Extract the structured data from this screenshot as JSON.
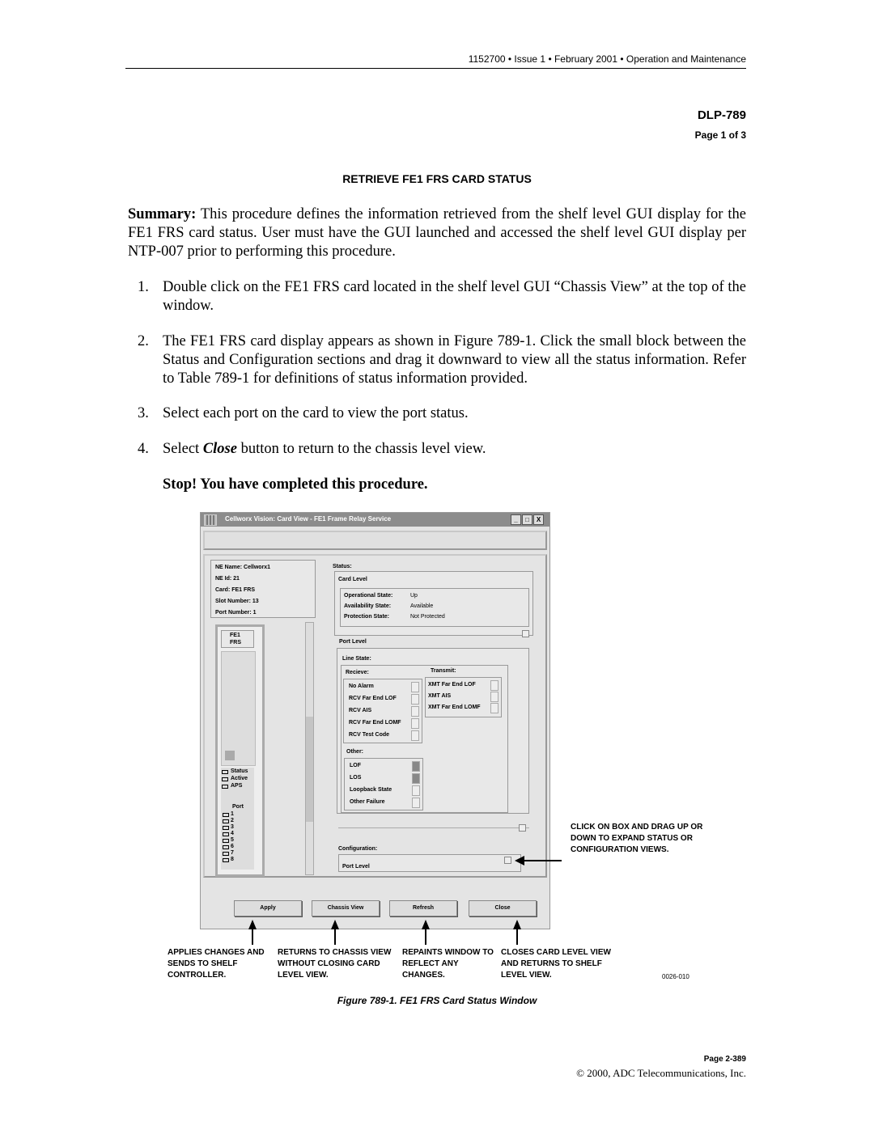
{
  "header": {
    "running": "1152700 • Issue 1 • February 2001 • Operation and Maintenance",
    "dlp": "DLP-789",
    "page": "Page 1 of 3"
  },
  "title": "RETRIEVE FE1 FRS CARD STATUS",
  "summary": {
    "label": "Summary:",
    "text": " This procedure defines the information retrieved from the shelf level GUI display for the FE1 FRS card status. User must have the GUI launched and accessed the shelf level GUI display per NTP-007 prior to performing this procedure."
  },
  "steps": [
    {
      "n": "1.",
      "text": "Double click on the FE1 FRS card located in the shelf level GUI “Chassis View” at the top of the window."
    },
    {
      "n": "2.",
      "text": "The FE1 FRS card display appears as shown in Figure 789-1. Click the small block between the Status and Configuration sections and drag it downward to view all the status information. Refer to Table 789-1 for definitions of status information provided."
    },
    {
      "n": "3.",
      "text": "Select each port on the card to view the port status."
    },
    {
      "n": "4.",
      "pre": "Select ",
      "em": "Close",
      "post": " button to return to the chassis level view."
    }
  ],
  "stop": "Stop! You have completed this procedure.",
  "window": {
    "title": "Cellworx Vision:   Card View - FE1 Frame Relay Service",
    "controls": [
      "_",
      "□",
      "X"
    ],
    "info": [
      "NE Name: Cellworx1",
      "NE Id:  21",
      "Card: FE1 FRS",
      "Slot Number:  13",
      "Port Number:  1"
    ],
    "card_label": [
      "FE1",
      "FRS"
    ],
    "leds": [
      "Status",
      "Active",
      "APS"
    ],
    "port_label": "Port",
    "ports": [
      "1",
      "2",
      "3",
      "4",
      "5",
      "6",
      "7",
      "8"
    ],
    "status_label": "Status:",
    "card_level": "Card Level",
    "states": [
      {
        "k": "Operational State:",
        "v": "Up"
      },
      {
        "k": "Availability State:",
        "v": "Available"
      },
      {
        "k": "Protection State:",
        "v": "Not Protected"
      }
    ],
    "port_level": "Port Level",
    "line_state": "Line State:",
    "receive_label": "Recieve:",
    "receive": [
      {
        "l": "No Alarm",
        "on": false
      },
      {
        "l": "RCV Far End LOF",
        "on": false
      },
      {
        "l": "RCV AIS",
        "on": false
      },
      {
        "l": "RCV Far End LOMF",
        "on": false
      },
      {
        "l": "RCV Test Code",
        "on": false
      }
    ],
    "transmit_label": "Transmit:",
    "transmit": [
      {
        "l": "XMT Far End LOF",
        "on": false
      },
      {
        "l": "XMT AIS",
        "on": false
      },
      {
        "l": "XMT Far End LOMF",
        "on": false
      }
    ],
    "other_label": "Other:",
    "other": [
      {
        "l": "LOF",
        "on": true
      },
      {
        "l": "LOS",
        "on": true
      },
      {
        "l": "Loopback State",
        "on": false
      },
      {
        "l": "Other Failure",
        "on": false
      }
    ],
    "config_label": "Configuration:",
    "config_port_level": "Port Level",
    "buttons": [
      "Apply",
      "Chassis View",
      "Refresh",
      "Close"
    ]
  },
  "callouts": {
    "drag": "CLICK ON BOX AND DRAG UP OR DOWN TO EXPAND STATUS OR CONFIGURATION VIEWS.",
    "apply": "APPLIES CHANGES AND SENDS TO SHELF CONTROLLER.",
    "chassis": "RETURNS TO CHASSIS VIEW WITHOUT CLOSING CARD LEVEL VIEW.",
    "refresh": "REPAINTS WINDOW TO REFLECT ANY CHANGES.",
    "close": "CLOSES CARD LEVEL VIEW AND RETURNS TO SHELF LEVEL VIEW.",
    "figid": "0026-010"
  },
  "figure_caption": "Figure 789-1. FE1 FRS Card Status Window",
  "footer": {
    "page": "Page 2-389",
    "copyright": "© 2000, ADC Telecommunications, Inc."
  }
}
